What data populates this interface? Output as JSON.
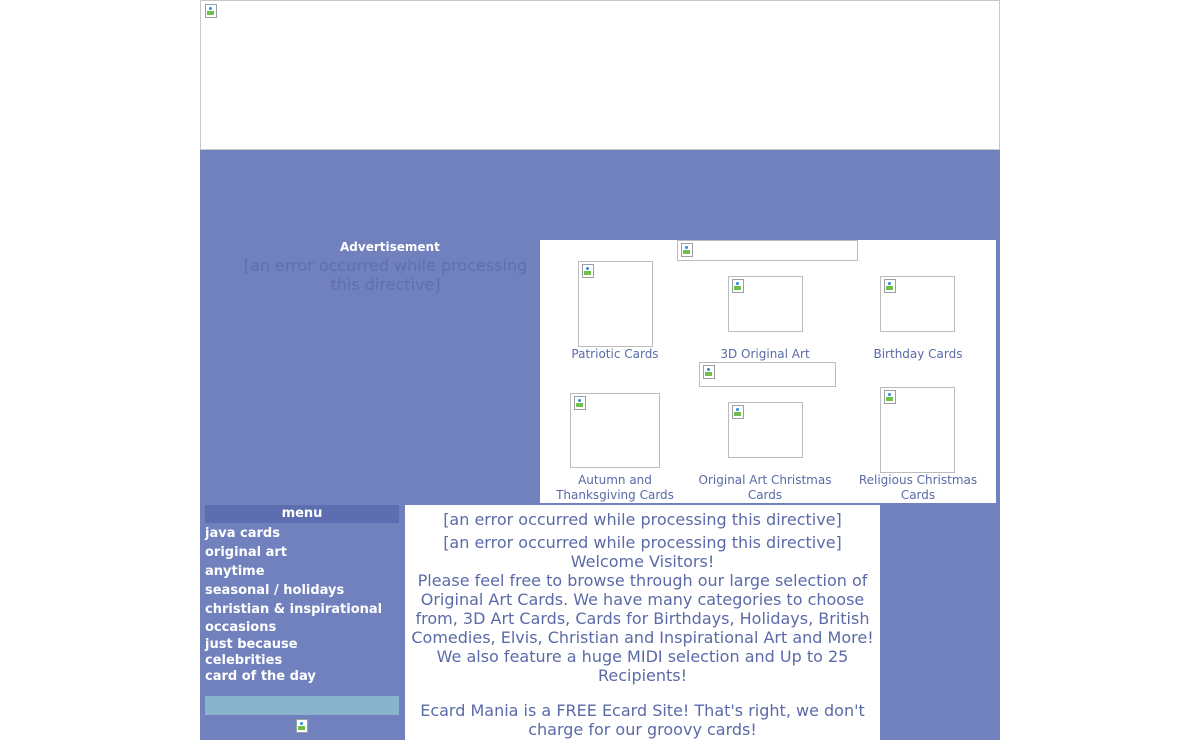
{
  "ad": {
    "label": "Advertisement",
    "error": "[an error occurred while processing this directive]"
  },
  "cards": [
    {
      "label": "Patriotic Cards"
    },
    {
      "label": "3D Original Art"
    },
    {
      "label": "Birthday Cards"
    },
    {
      "label": "Autumn and Thanksgiving Cards"
    },
    {
      "label": "Original Art Christmas Cards"
    },
    {
      "label": "Religious Christmas Cards"
    }
  ],
  "menu": {
    "title": "menu",
    "items": [
      {
        "label": "java cards"
      },
      {
        "label": "original art"
      },
      {
        "label": "anytime"
      },
      {
        "label": "seasonal / holidays"
      },
      {
        "label": "christian & inspirational"
      },
      {
        "label": "occasions"
      },
      {
        "label": "just because"
      },
      {
        "label": "celebrities"
      },
      {
        "label": "card of the day"
      }
    ]
  },
  "content": {
    "error1": "[an error occurred while processing this directive]",
    "error2": "[an error occurred while processing this directive]",
    "welcome": "Welcome Visitors!",
    "para1": "Please feel free to browse through our large selection of Original Art Cards. We have many categories to choose from, 3D Art Cards, Cards for Birthdays, Holidays, British Comedies, Elvis, Christian and Inspirational Art and More! We also feature a huge MIDI selection and Up to 25 Recipients!",
    "para2": "Ecard Mania is a FREE Ecard Site!  That's right, we don't charge for our groovy cards!"
  }
}
